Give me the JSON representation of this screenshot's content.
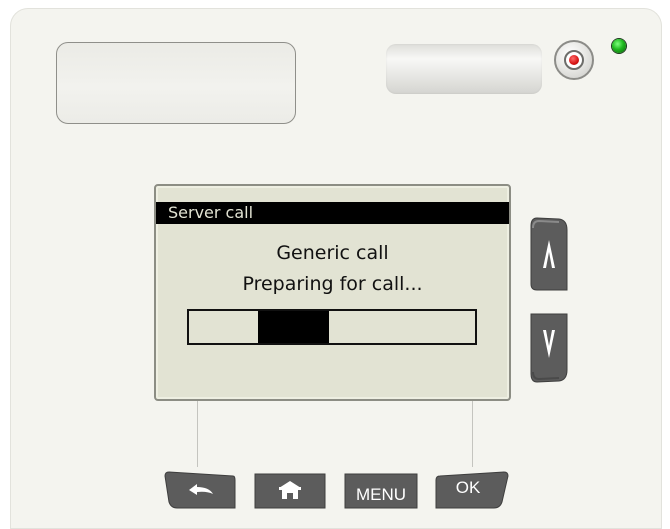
{
  "device": {
    "status_led": "on",
    "colors": {
      "body": "#f4f4ef",
      "lcd_background": "#e2e3d3",
      "lcd_text": "#111111",
      "button_dark": "#5c5c5c",
      "power_red": "#d61414",
      "led_green": "#1fb81f"
    }
  },
  "lcd": {
    "title": "Server call",
    "line1": "Generic call",
    "line2": "Preparing for call...",
    "progress": {
      "indeterminate": true,
      "highlight_start": 0.24,
      "highlight_end": 0.49
    }
  },
  "side_buttons": {
    "up_icon": "arrow-up-icon",
    "down_icon": "arrow-down-icon"
  },
  "bottom_buttons": {
    "back_icon": "back-arrow-icon",
    "home_icon": "home-icon",
    "menu_label": "MENU",
    "ok_label": "OK"
  }
}
